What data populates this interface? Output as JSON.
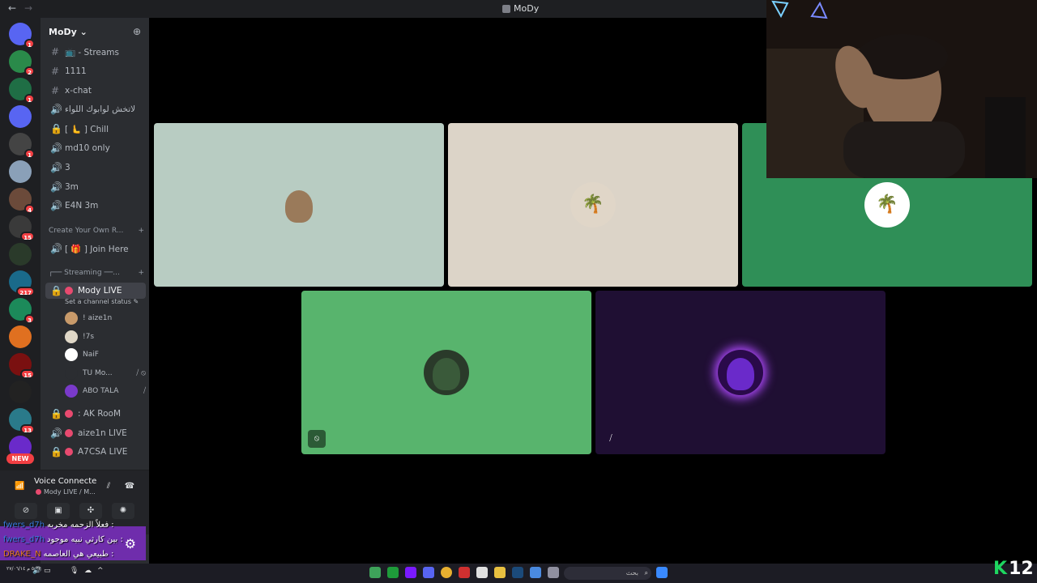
{
  "window": {
    "title": "MoDy",
    "back": "←",
    "forward": "→"
  },
  "guilds": [
    {
      "color": "#5865f2",
      "badge": "1",
      "icon": "discord-icon"
    },
    {
      "color": "#2a8a4a",
      "badge": "2",
      "icon": "palm-server-icon"
    },
    {
      "color": "#1f6e45",
      "badge": "1",
      "icon": "gears-server-icon"
    },
    {
      "color": "#5865f2",
      "badge": "",
      "icon": "folder-icon"
    },
    {
      "color": "#444",
      "badge": "1",
      "icon": "server-icon"
    },
    {
      "color": "#8aa0b8",
      "badge": "",
      "icon": "server-icon"
    },
    {
      "color": "#6b4a3a",
      "badge": "4",
      "icon": "server-icon"
    },
    {
      "color": "#3a3a3a",
      "badge": "15",
      "icon": "server-icon"
    },
    {
      "color": "#2a3a2a",
      "badge": "",
      "icon": "server-icon"
    },
    {
      "color": "#1a6a8a",
      "badge": "217",
      "icon": "server-icon"
    },
    {
      "color": "#1c8a5a",
      "badge": "3",
      "icon": "server-icon"
    },
    {
      "color": "#e07020",
      "badge": "",
      "icon": "server-icon"
    },
    {
      "color": "#7a1010",
      "badge": "15",
      "icon": "server-icon"
    },
    {
      "color": "#222",
      "badge": "",
      "icon": "server-icon"
    },
    {
      "color": "#2a7a8a",
      "badge": "13",
      "icon": "server-icon"
    },
    {
      "color": "#6a2aca",
      "badge": "",
      "icon": "server-icon"
    }
  ],
  "new_badge": "NEW",
  "server": {
    "name": "MoDy",
    "chevron": "⌄",
    "add_icon": "add-member-icon"
  },
  "channels": [
    {
      "sym": "#",
      "label": "📺 - Streams",
      "type": "text"
    },
    {
      "sym": "#",
      "label": "1111",
      "type": "text"
    },
    {
      "sym": "#",
      "label": "x-chat",
      "type": "text"
    },
    {
      "sym": "🔊",
      "label": "لاتخش لوابوك اللواء",
      "type": "voice"
    },
    {
      "sym": "🔒",
      "label": "[ 🫷 ] Chill",
      "type": "voice-locked"
    },
    {
      "sym": "🔊",
      "label": "md10 only",
      "type": "voice"
    },
    {
      "sym": "🔊",
      "label": "3",
      "type": "voice"
    },
    {
      "sym": "🔊",
      "label": "3m",
      "type": "voice"
    },
    {
      "sym": "🔊",
      "label": "E4N 3m",
      "type": "voice"
    }
  ],
  "category_create": {
    "label": "Create Your Own R...",
    "chev": "⌄",
    "plus": "+"
  },
  "join_here": {
    "sym": "🔊",
    "label": "[ 🎁 ] Join Here"
  },
  "category_streaming": {
    "label": "┌── Streaming ──...",
    "plus": "+"
  },
  "active_channel": {
    "label": "Mody LIVE",
    "status": "Set a channel status ✎"
  },
  "members": [
    {
      "name": "! aize1n",
      "color": "#c89a6a",
      "icons": ""
    },
    {
      "name": "!7s",
      "color": "#e0d8c8",
      "icons": ""
    },
    {
      "name": "NaiF",
      "color": "#ffffff",
      "icons": ""
    },
    {
      "name": "TU Mo...",
      "color": "#2b2d31",
      "icons": "⧸ ⦸"
    },
    {
      "name": "ABO TALA",
      "color": "#7a3aca",
      "icons": "⧸"
    }
  ],
  "other_channels": [
    {
      "label": ": AK RooM"
    },
    {
      "label": "aize1n LIVE"
    },
    {
      "label": "A7CSA LIVE"
    }
  ],
  "voice_panel": {
    "title": "Voice Connecte",
    "subtitle": "Mody LIVE / M...",
    "signal": "📶"
  },
  "voice_buttons": [
    {
      "icon": "camera-off-icon",
      "glyph": "⊘"
    },
    {
      "icon": "screen-share-icon",
      "glyph": "▣"
    },
    {
      "icon": "activities-icon",
      "glyph": "✣"
    },
    {
      "icon": "soundboard-icon",
      "glyph": "✺"
    }
  ],
  "voice_right_buttons": [
    {
      "icon": "noise-suppression-icon",
      "glyph": "⫽"
    },
    {
      "icon": "disconnect-icon",
      "glyph": "☎"
    }
  ],
  "chat_overlay": [
    {
      "name": "fwers_d7h",
      "name_color": "#3a7de0",
      "msg": "فعلاً الزحمه مخربه :"
    },
    {
      "name": "fwers_d7h",
      "name_color": "#3a7de0",
      "msg": "بين كارثي نبيه موجود :"
    },
    {
      "name": "DRAKE_N",
      "name_color": "#e07a20",
      "msg": "طبيعي هي العاصمه :"
    }
  ],
  "tiles": [
    {
      "bg": "#b8ccc2",
      "avatar_color": "#9a7a5a",
      "avatar_bg": "#b8ccc2",
      "glyph": "",
      "icon": ""
    },
    {
      "bg": "#dcd4c8",
      "avatar_color": "#d8c9b6",
      "avatar_bg": "#e0d6c8",
      "glyph": "🌴",
      "icon": ""
    },
    {
      "bg": "#2f8f57",
      "avatar_color": "#ffffff",
      "avatar_bg": "#ffffff",
      "glyph": "🌴",
      "icon": ""
    },
    {
      "bg": "#58b46d",
      "avatar_color": "#3a5a3a",
      "avatar_bg": "#2a3a2a",
      "glyph": "",
      "icon": "⦸"
    },
    {
      "bg": "#1f0f33",
      "avatar_color": "#6a2aca",
      "avatar_bg": "#2a0a4a",
      "glyph": "",
      "icon": "⧸"
    }
  ],
  "taskbar": {
    "clock": "٥:٣٢ م\n٢٧/٠٦/١٤",
    "search_text": "بحث",
    "search_icon": "⌕"
  },
  "watermark": {
    "k": "K",
    "num": "12"
  }
}
